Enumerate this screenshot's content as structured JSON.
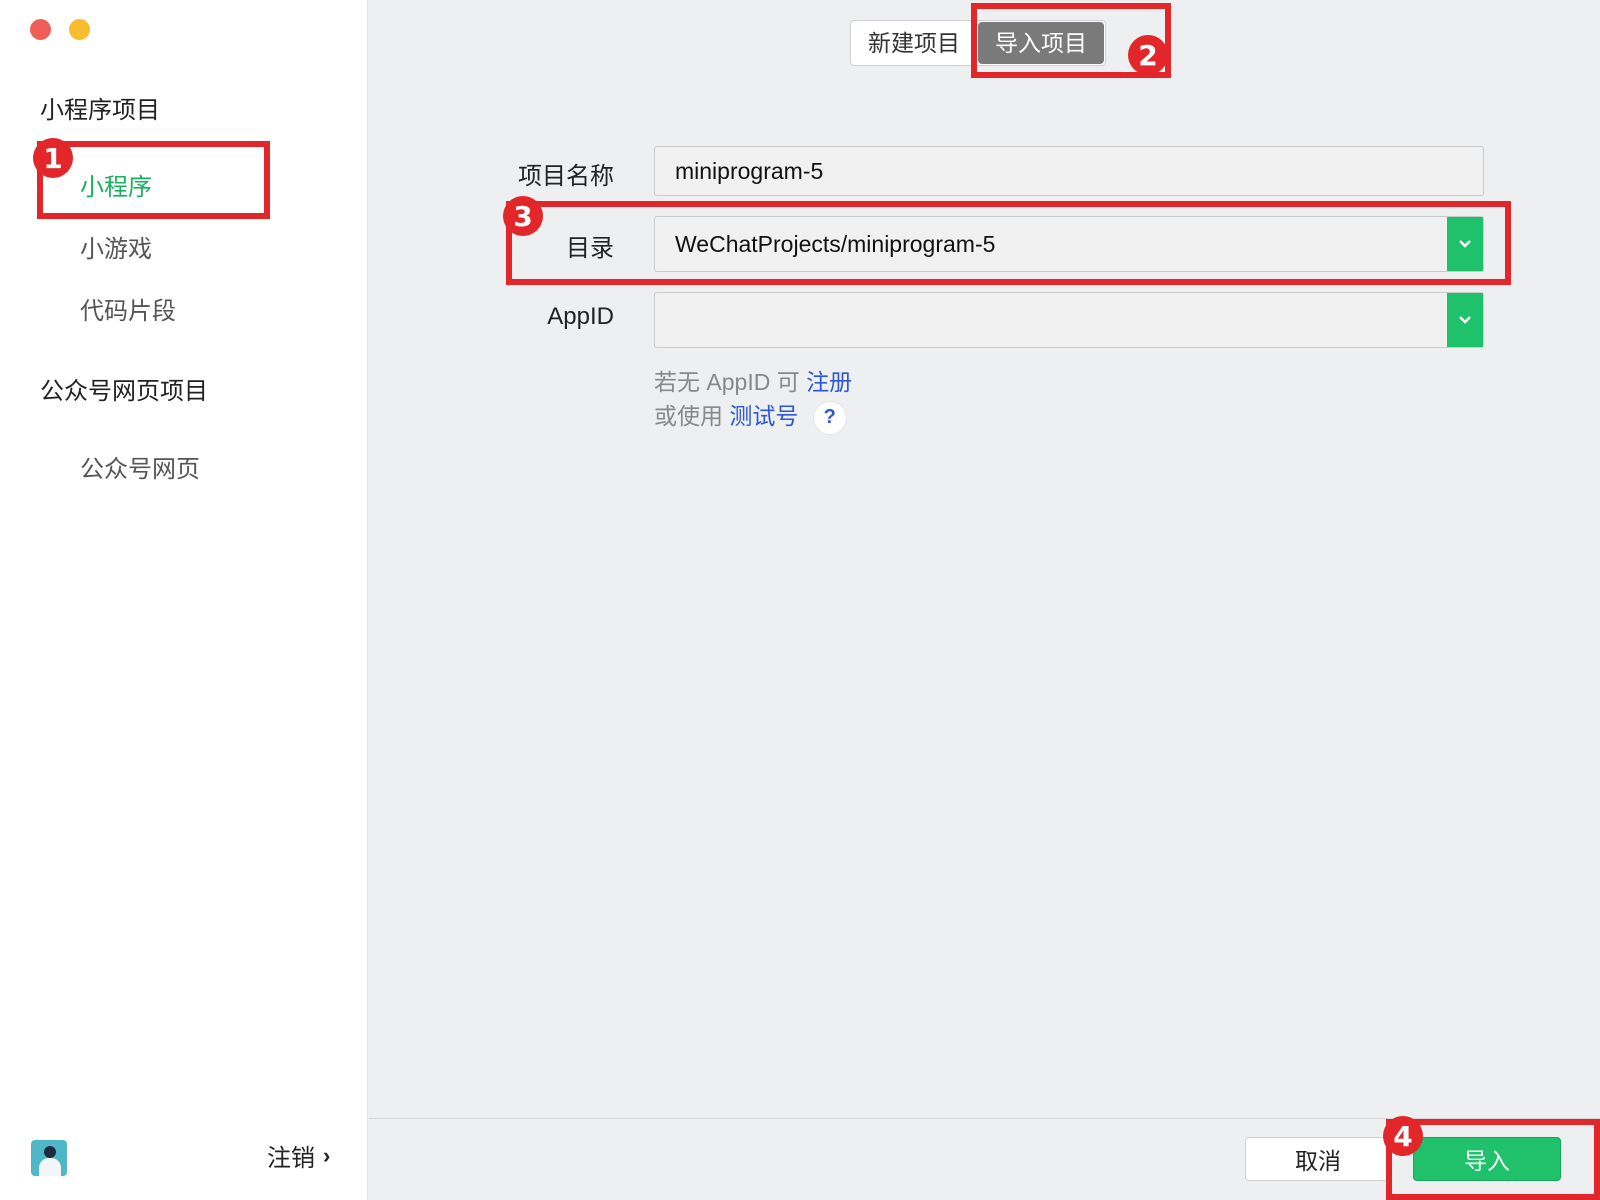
{
  "window": {
    "traffic_lights": [
      "close",
      "minimize"
    ],
    "colors": {
      "close": "#ef5f57",
      "minimize": "#f7bd2e"
    }
  },
  "sidebar": {
    "group1_title": "小程序项目",
    "items1": [
      {
        "label": "小程序",
        "active": true
      },
      {
        "label": "小游戏",
        "active": false
      },
      {
        "label": "代码片段",
        "active": false
      }
    ],
    "group2_title": "公众号网页项目",
    "items2": [
      {
        "label": "公众号网页",
        "active": false
      }
    ],
    "logout_label": "注销",
    "logout_icon": "chevron-right-icon",
    "avatar_icon": "user-avatar"
  },
  "tabs": [
    {
      "label": "新建项目",
      "active": false
    },
    {
      "label": "导入项目",
      "active": true
    }
  ],
  "form": {
    "name_label": "项目名称",
    "name_value": "miniprogram-5",
    "dir_label": "目录",
    "dir_value": "WeChatProjects/miniprogram-5",
    "appid_label": "AppID",
    "appid_value": "",
    "hint1_prefix": "若无 AppID 可",
    "hint1_link": "注册",
    "hint2_prefix": "或使用",
    "hint2_link": "测试号",
    "help_icon": "?"
  },
  "footer": {
    "cancel_label": "取消",
    "import_label": "导入"
  },
  "annotations": [
    "1",
    "2",
    "3",
    "4"
  ],
  "colors": {
    "accent_green": "#1fc16b",
    "active_text_green": "#17b15e",
    "link_blue": "#2d57d6",
    "annotation_red": "#e3262a"
  }
}
